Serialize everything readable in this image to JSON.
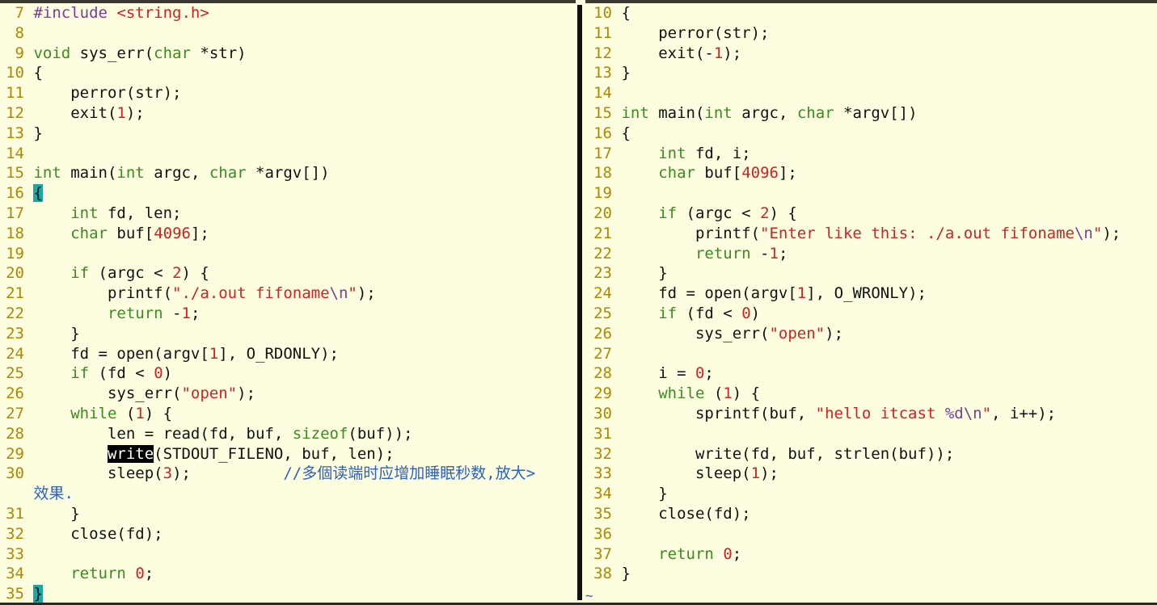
{
  "left": {
    "lines": [
      {
        "n": "7",
        "tokens": [
          {
            "t": "#include ",
            "c": "pre"
          },
          {
            "t": "<string.h>",
            "c": "str"
          }
        ]
      },
      {
        "n": "8",
        "tokens": []
      },
      {
        "n": "9",
        "tokens": [
          {
            "t": "void",
            "c": "kw"
          },
          {
            "t": " sys_err(",
            "c": ""
          },
          {
            "t": "char",
            "c": "kw"
          },
          {
            "t": " *str)",
            "c": ""
          }
        ]
      },
      {
        "n": "10",
        "tokens": [
          {
            "t": "{",
            "c": ""
          }
        ]
      },
      {
        "n": "11",
        "tokens": [
          {
            "t": "    perror(str);",
            "c": ""
          }
        ]
      },
      {
        "n": "12",
        "tokens": [
          {
            "t": "    exit(",
            "c": ""
          },
          {
            "t": "1",
            "c": "num"
          },
          {
            "t": ");",
            "c": ""
          }
        ]
      },
      {
        "n": "13",
        "tokens": [
          {
            "t": "}",
            "c": ""
          }
        ]
      },
      {
        "n": "14",
        "tokens": []
      },
      {
        "n": "15",
        "tokens": [
          {
            "t": "int",
            "c": "kw"
          },
          {
            "t": " main(",
            "c": ""
          },
          {
            "t": "int",
            "c": "kw"
          },
          {
            "t": " argc, ",
            "c": ""
          },
          {
            "t": "char",
            "c": "kw"
          },
          {
            "t": " *argv[])",
            "c": ""
          }
        ]
      },
      {
        "n": "16",
        "tokens": [
          {
            "t": "{",
            "c": "cur"
          }
        ]
      },
      {
        "n": "17",
        "tokens": [
          {
            "t": "    ",
            "c": ""
          },
          {
            "t": "int",
            "c": "kw"
          },
          {
            "t": " fd, len;",
            "c": ""
          }
        ]
      },
      {
        "n": "18",
        "tokens": [
          {
            "t": "    ",
            "c": ""
          },
          {
            "t": "char",
            "c": "kw"
          },
          {
            "t": " buf[",
            "c": ""
          },
          {
            "t": "4096",
            "c": "num"
          },
          {
            "t": "];",
            "c": ""
          }
        ]
      },
      {
        "n": "19",
        "tokens": []
      },
      {
        "n": "20",
        "tokens": [
          {
            "t": "    ",
            "c": ""
          },
          {
            "t": "if",
            "c": "kw"
          },
          {
            "t": " (argc < ",
            "c": ""
          },
          {
            "t": "2",
            "c": "num"
          },
          {
            "t": ") {",
            "c": ""
          }
        ]
      },
      {
        "n": "21",
        "tokens": [
          {
            "t": "        printf(",
            "c": ""
          },
          {
            "t": "\"./a.out fifoname",
            "c": "str"
          },
          {
            "t": "\\n",
            "c": "pre"
          },
          {
            "t": "\"",
            "c": "str"
          },
          {
            "t": ");",
            "c": ""
          }
        ]
      },
      {
        "n": "22",
        "tokens": [
          {
            "t": "        ",
            "c": ""
          },
          {
            "t": "return",
            "c": "kw"
          },
          {
            "t": " -",
            "c": ""
          },
          {
            "t": "1",
            "c": "num"
          },
          {
            "t": ";",
            "c": ""
          }
        ]
      },
      {
        "n": "23",
        "tokens": [
          {
            "t": "    }",
            "c": ""
          }
        ]
      },
      {
        "n": "24",
        "tokens": [
          {
            "t": "    fd = open(argv[",
            "c": ""
          },
          {
            "t": "1",
            "c": "num"
          },
          {
            "t": "], O_RDONLY);",
            "c": ""
          }
        ]
      },
      {
        "n": "25",
        "tokens": [
          {
            "t": "    ",
            "c": ""
          },
          {
            "t": "if",
            "c": "kw"
          },
          {
            "t": " (fd < ",
            "c": ""
          },
          {
            "t": "0",
            "c": "num"
          },
          {
            "t": ")",
            "c": ""
          }
        ]
      },
      {
        "n": "26",
        "tokens": [
          {
            "t": "        sys_err(",
            "c": ""
          },
          {
            "t": "\"open\"",
            "c": "str"
          },
          {
            "t": ");",
            "c": ""
          }
        ]
      },
      {
        "n": "27",
        "tokens": [
          {
            "t": "    ",
            "c": ""
          },
          {
            "t": "while",
            "c": "kw"
          },
          {
            "t": " (",
            "c": ""
          },
          {
            "t": "1",
            "c": "num"
          },
          {
            "t": ") {",
            "c": ""
          }
        ]
      },
      {
        "n": "28",
        "tokens": [
          {
            "t": "        len = read(fd, buf, ",
            "c": ""
          },
          {
            "t": "sizeof",
            "c": "kw"
          },
          {
            "t": "(buf));",
            "c": ""
          }
        ]
      },
      {
        "n": "29",
        "tokens": [
          {
            "t": "        ",
            "c": ""
          },
          {
            "t": "write",
            "c": "sel"
          },
          {
            "t": "(STDOUT_FILENO, buf, len);",
            "c": ""
          }
        ]
      },
      {
        "n": "30",
        "tokens": [
          {
            "t": "        sleep(",
            "c": ""
          },
          {
            "t": "3",
            "c": "num"
          },
          {
            "t": ");          ",
            "c": ""
          },
          {
            "t": "//多個读端时应增加睡眠秒数,放大>",
            "c": "cmt"
          }
        ]
      },
      {
        "n": "",
        "tokens": [
          {
            "t": "效果.",
            "c": "cmt"
          }
        ]
      },
      {
        "n": "31",
        "tokens": [
          {
            "t": "    }",
            "c": ""
          }
        ]
      },
      {
        "n": "32",
        "tokens": [
          {
            "t": "    close(fd);",
            "c": ""
          }
        ]
      },
      {
        "n": "33",
        "tokens": []
      },
      {
        "n": "34",
        "tokens": [
          {
            "t": "    ",
            "c": ""
          },
          {
            "t": "return",
            "c": "kw"
          },
          {
            "t": " ",
            "c": ""
          },
          {
            "t": "0",
            "c": "num"
          },
          {
            "t": ";",
            "c": ""
          }
        ]
      },
      {
        "n": "35",
        "tokens": [
          {
            "t": "}",
            "c": "cur"
          }
        ]
      }
    ]
  },
  "right": {
    "lines": [
      {
        "n": "10",
        "tokens": [
          {
            "t": "{",
            "c": ""
          }
        ]
      },
      {
        "n": "11",
        "tokens": [
          {
            "t": "    perror(str);",
            "c": ""
          }
        ]
      },
      {
        "n": "12",
        "tokens": [
          {
            "t": "    exit(-",
            "c": ""
          },
          {
            "t": "1",
            "c": "num"
          },
          {
            "t": ");",
            "c": ""
          }
        ]
      },
      {
        "n": "13",
        "tokens": [
          {
            "t": "}",
            "c": ""
          }
        ]
      },
      {
        "n": "14",
        "tokens": []
      },
      {
        "n": "15",
        "tokens": [
          {
            "t": "int",
            "c": "kw"
          },
          {
            "t": " main(",
            "c": ""
          },
          {
            "t": "int",
            "c": "kw"
          },
          {
            "t": " argc, ",
            "c": ""
          },
          {
            "t": "char",
            "c": "kw"
          },
          {
            "t": " *argv[])",
            "c": ""
          }
        ]
      },
      {
        "n": "16",
        "tokens": [
          {
            "t": "{",
            "c": ""
          }
        ]
      },
      {
        "n": "17",
        "tokens": [
          {
            "t": "    ",
            "c": ""
          },
          {
            "t": "int",
            "c": "kw"
          },
          {
            "t": " fd, i;",
            "c": ""
          }
        ]
      },
      {
        "n": "18",
        "tokens": [
          {
            "t": "    ",
            "c": ""
          },
          {
            "t": "char",
            "c": "kw"
          },
          {
            "t": " buf[",
            "c": ""
          },
          {
            "t": "4096",
            "c": "num"
          },
          {
            "t": "];",
            "c": ""
          }
        ]
      },
      {
        "n": "19",
        "tokens": []
      },
      {
        "n": "20",
        "tokens": [
          {
            "t": "    ",
            "c": ""
          },
          {
            "t": "if",
            "c": "kw"
          },
          {
            "t": " (argc < ",
            "c": ""
          },
          {
            "t": "2",
            "c": "num"
          },
          {
            "t": ") {",
            "c": ""
          }
        ]
      },
      {
        "n": "21",
        "tokens": [
          {
            "t": "        printf(",
            "c": ""
          },
          {
            "t": "\"Enter like this: ./a.out fifoname",
            "c": "str"
          },
          {
            "t": "\\n",
            "c": "pre"
          },
          {
            "t": "\"",
            "c": "str"
          },
          {
            "t": ");",
            "c": ""
          }
        ]
      },
      {
        "n": "22",
        "tokens": [
          {
            "t": "        ",
            "c": ""
          },
          {
            "t": "return",
            "c": "kw"
          },
          {
            "t": " -",
            "c": ""
          },
          {
            "t": "1",
            "c": "num"
          },
          {
            "t": ";",
            "c": ""
          }
        ]
      },
      {
        "n": "23",
        "tokens": [
          {
            "t": "    }",
            "c": ""
          }
        ]
      },
      {
        "n": "24",
        "tokens": [
          {
            "t": "    fd = open(argv[",
            "c": ""
          },
          {
            "t": "1",
            "c": "num"
          },
          {
            "t": "], O_WRONLY);",
            "c": ""
          }
        ]
      },
      {
        "n": "25",
        "tokens": [
          {
            "t": "    ",
            "c": ""
          },
          {
            "t": "if",
            "c": "kw"
          },
          {
            "t": " (fd < ",
            "c": ""
          },
          {
            "t": "0",
            "c": "num"
          },
          {
            "t": ")",
            "c": ""
          }
        ]
      },
      {
        "n": "26",
        "tokens": [
          {
            "t": "        sys_err(",
            "c": ""
          },
          {
            "t": "\"open\"",
            "c": "str"
          },
          {
            "t": ");",
            "c": ""
          }
        ]
      },
      {
        "n": "27",
        "tokens": []
      },
      {
        "n": "28",
        "tokens": [
          {
            "t": "    i = ",
            "c": ""
          },
          {
            "t": "0",
            "c": "num"
          },
          {
            "t": ";",
            "c": ""
          }
        ]
      },
      {
        "n": "29",
        "tokens": [
          {
            "t": "    ",
            "c": ""
          },
          {
            "t": "while",
            "c": "kw"
          },
          {
            "t": " (",
            "c": ""
          },
          {
            "t": "1",
            "c": "num"
          },
          {
            "t": ") {",
            "c": ""
          }
        ]
      },
      {
        "n": "30",
        "tokens": [
          {
            "t": "        sprintf(buf, ",
            "c": ""
          },
          {
            "t": "\"hello itcast ",
            "c": "str"
          },
          {
            "t": "%d\\n",
            "c": "pre"
          },
          {
            "t": "\"",
            "c": "str"
          },
          {
            "t": ", i++);",
            "c": ""
          }
        ]
      },
      {
        "n": "31",
        "tokens": []
      },
      {
        "n": "32",
        "tokens": [
          {
            "t": "        write(fd, buf, strlen(buf));",
            "c": ""
          }
        ]
      },
      {
        "n": "33",
        "tokens": [
          {
            "t": "        sleep(",
            "c": ""
          },
          {
            "t": "1",
            "c": "num"
          },
          {
            "t": ");",
            "c": ""
          }
        ]
      },
      {
        "n": "34",
        "tokens": [
          {
            "t": "    }",
            "c": ""
          }
        ]
      },
      {
        "n": "35",
        "tokens": [
          {
            "t": "    close(fd);",
            "c": ""
          }
        ]
      },
      {
        "n": "36",
        "tokens": []
      },
      {
        "n": "37",
        "tokens": [
          {
            "t": "    ",
            "c": ""
          },
          {
            "t": "return",
            "c": "kw"
          },
          {
            "t": " ",
            "c": ""
          },
          {
            "t": "0",
            "c": "num"
          },
          {
            "t": ";",
            "c": ""
          }
        ]
      },
      {
        "n": "38",
        "tokens": [
          {
            "t": "}",
            "c": ""
          }
        ]
      }
    ],
    "tilde": "~"
  },
  "colors": {
    "background": "#fdfde0",
    "keyword": "#3c8b1f",
    "number": "#d42020",
    "line_number": "#b08800",
    "comment": "#2e60c4",
    "cursor": "#1ca6a6"
  }
}
